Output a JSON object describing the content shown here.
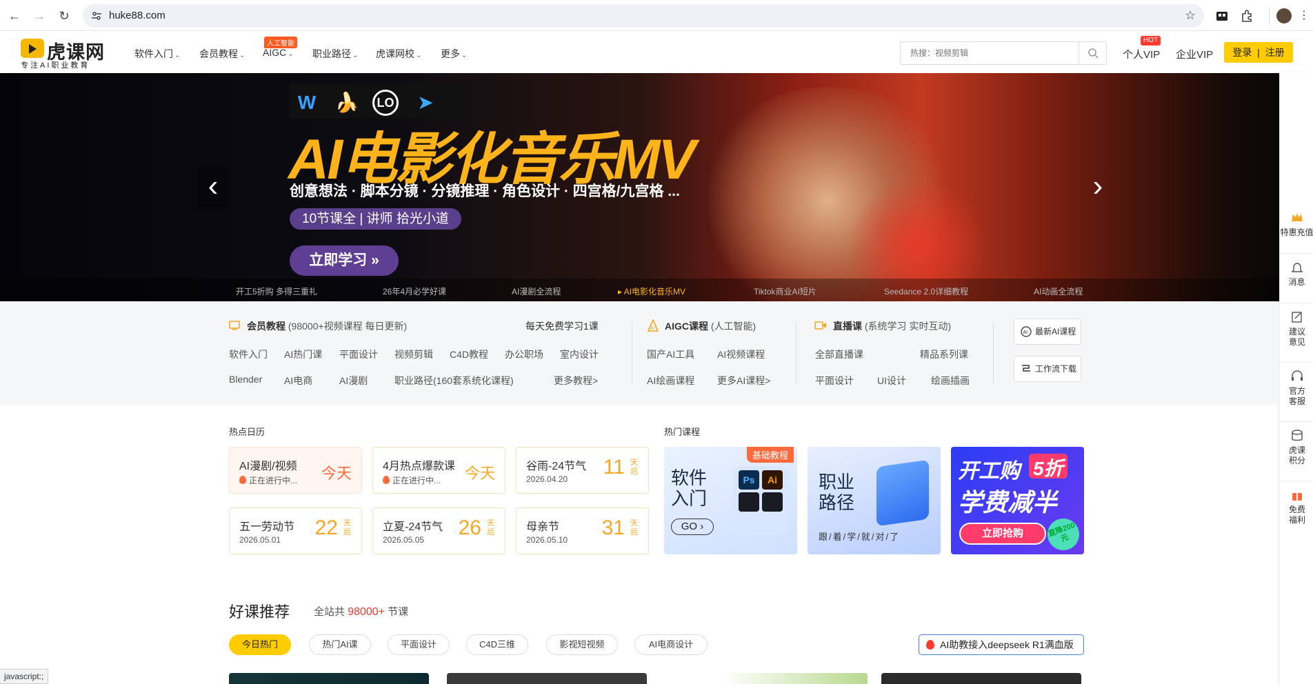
{
  "browser": {
    "url": "huke88.com"
  },
  "header": {
    "logo_text": "虎课网",
    "logo_sub": "专注AI职业教育",
    "nav": [
      "软件入门",
      "会员教程",
      "AIGC",
      "职业路径",
      "虎课网校",
      "更多"
    ],
    "ai_badge": "人工智能",
    "search_placeholder": "热搜：视频剪辑",
    "personal_vip": "个人VIP",
    "hot_badge": "HOT",
    "enterprise_vip": "企业VIP",
    "login": "登录",
    "register": "注册",
    "login_divider": "|"
  },
  "banner": {
    "title": "AI电影化音乐MV",
    "subtitle": "创意想法 · 脚本分镜 · 分镜推理 · 角色设计 · 四宫格/九宫格 ...",
    "pill": "10节课全 | 讲师 拾光小道",
    "cta": "立即学习 »",
    "tabs": [
      "开工5折购 多得三重礼",
      "26年4月必学好课",
      "AI漫剧全流程",
      "AI电影化音乐MV",
      "Tiktok商业AI短片",
      "Seedance 2.0详细教程",
      "AI动画全流程"
    ],
    "active_tab": 3
  },
  "sidebar": [
    {
      "label": "特惠充值",
      "icon": "crown-icon"
    },
    {
      "label": "消息",
      "icon": "bell-icon"
    },
    {
      "label": "建议意见",
      "icon": "edit-icon"
    },
    {
      "label": "官方客服",
      "icon": "headset-icon"
    },
    {
      "label": "虎课积分",
      "icon": "coins-icon"
    },
    {
      "label": "免费福利",
      "icon": "gift-icon"
    }
  ],
  "categories": {
    "member": {
      "title": "会员教程",
      "desc": "(98000+视频课程 每日更新)",
      "daily": "每天免费学习1课",
      "row1": [
        "软件入门",
        "AI热门课",
        "平面设计",
        "视频剪辑",
        "C4D教程",
        "办公职场",
        "室内设计"
      ],
      "row2": [
        "Blender",
        "AI电商",
        "AI漫剧",
        "职业路径(160套系统化课程)",
        "更多教程>"
      ]
    },
    "aigc": {
      "title": "AIGC课程",
      "desc": "(人工智能)",
      "row1": [
        "国产AI工具",
        "AI视频课程"
      ],
      "row2": [
        "AI绘画课程",
        "更多AI课程>"
      ]
    },
    "live": {
      "title": "直播课",
      "desc": "(系统学习 实时互动)",
      "row1": [
        "全部直播课",
        "精品系列课"
      ],
      "row2": [
        "平面设计",
        "UI设计",
        "绘画插画"
      ]
    },
    "buttons": [
      "最新AI课程",
      "工作流下载"
    ]
  },
  "calendar": {
    "title": "热点日历",
    "items": [
      {
        "name": "AI漫剧/视频",
        "sub": "正在进行中...",
        "tag": "今天"
      },
      {
        "name": "4月热点爆款课",
        "sub": "正在进行中...",
        "tag": "今天"
      },
      {
        "name": "谷雨-24节气",
        "sub": "2026.04.20",
        "num": "11",
        "unit": "天后"
      },
      {
        "name": "五一劳动节",
        "sub": "2026.05.01",
        "num": "22",
        "unit": "天后"
      },
      {
        "name": "立夏-24节气",
        "sub": "2026.05.05",
        "num": "26",
        "unit": "天后"
      },
      {
        "name": "母亲节",
        "sub": "2026.05.10",
        "num": "31",
        "unit": "天后"
      }
    ]
  },
  "hot_courses": {
    "title": "热门课程",
    "cards": [
      {
        "title": "软件入门",
        "badge": "基础教程",
        "cta": "GO"
      },
      {
        "title": "职业路径",
        "sub": "跟/着/学/就/对/了"
      },
      {
        "title": "开工购",
        "discount": "5折",
        "headline": "学费减半",
        "cta": "立即抢购",
        "stamp": "直降200元"
      }
    ]
  },
  "recommend": {
    "title": "好课推荐",
    "prefix": "全站共",
    "count": "98000+",
    "suffix": "节课",
    "tabs": [
      "今日热门",
      "热门AI课",
      "平面设计",
      "C4D三维",
      "影视短视频",
      "AI电商设计"
    ],
    "active_tab": 0,
    "deepseek": "AI助教接入deepseek R1满血版"
  },
  "status_bar": "javascript:;"
}
